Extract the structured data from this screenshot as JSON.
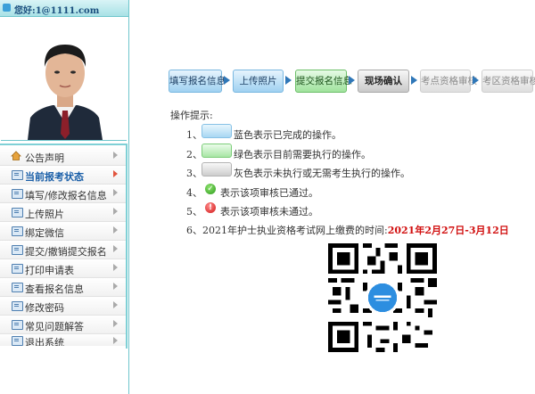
{
  "sidebar": {
    "greeting": "您好:1@1111.com",
    "menu": [
      {
        "label": "公告声明"
      },
      {
        "label": "当前报考状态"
      },
      {
        "label": "填写/修改报名信息"
      },
      {
        "label": "上传照片"
      },
      {
        "label": "绑定微信"
      },
      {
        "label": "提交/撤销提交报名"
      },
      {
        "label": "打印申请表"
      },
      {
        "label": "查看报名信息"
      },
      {
        "label": "修改密码"
      },
      {
        "label": "常见问题解答"
      },
      {
        "label": "退出系统"
      }
    ]
  },
  "steps": [
    {
      "label": "填写报名信息"
    },
    {
      "label": "上传照片"
    },
    {
      "label": "提交报名信息"
    },
    {
      "label": "现场确认"
    },
    {
      "label": "考点资格审核"
    },
    {
      "label": "考区资格审核"
    }
  ],
  "tips": {
    "title": "操作提示:",
    "n1": "1、",
    "t1": "蓝色表示已完成的操作。",
    "n2": "2、",
    "t2": "绿色表示目前需要执行的操作。",
    "n3": "3、",
    "t3": "灰色表示未执行或无需考生执行的操作。",
    "n4": "4、",
    "t4": "表示该项审核已通过。",
    "n5": "5、",
    "t5": "表示该项审核未通过。",
    "t6": "6、2021年护士执业资格考试网上缴费的时间:",
    "t6_date": "2021年2月27日-3月12日"
  }
}
